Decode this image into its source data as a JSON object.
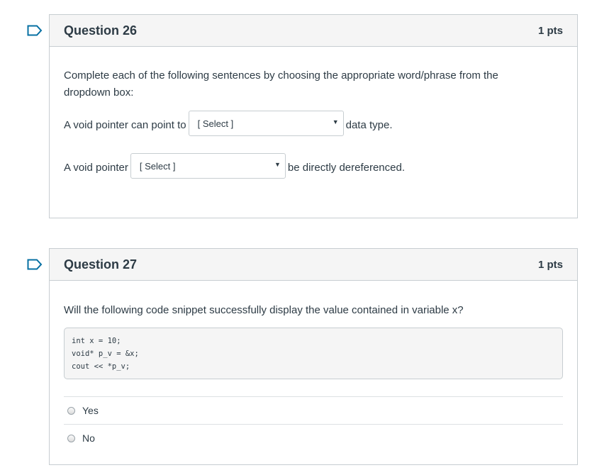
{
  "questions": [
    {
      "title": "Question 26",
      "points": "1 pts",
      "instructions": "Complete each of the following sentences by choosing the appropriate word/phrase from the dropdown box:",
      "sentences": [
        {
          "before": "A void pointer can point to",
          "select": "[ Select ]",
          "after": "data type."
        },
        {
          "before": "A void pointer",
          "select": "[ Select ]",
          "after": "be directly dereferenced."
        }
      ]
    },
    {
      "title": "Question 27",
      "points": "1 pts",
      "prompt": "Will the following code snippet successfully display the value contained in variable x?",
      "code": "int x = 10;\nvoid* p_v = &x;\ncout << *p_v;",
      "answers": [
        "Yes",
        "No"
      ]
    }
  ],
  "colors": {
    "flag": "#0770a3",
    "border": "#c7cdd1",
    "header_bg": "#f5f5f5"
  },
  "icons": {
    "flag": "bookmark-flag-icon",
    "dropdown": "caret-down-icon"
  }
}
